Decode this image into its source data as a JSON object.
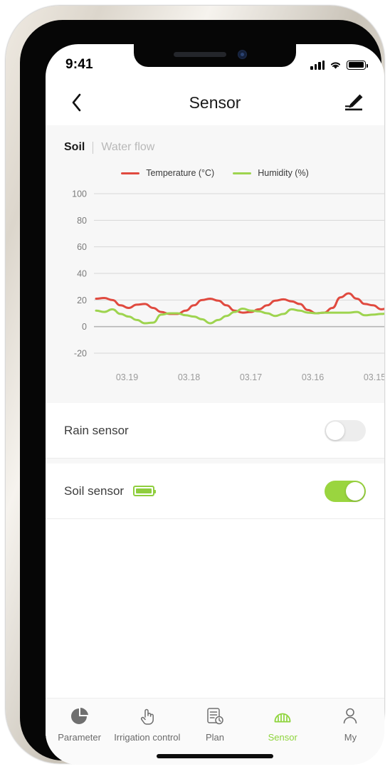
{
  "status_bar": {
    "time": "9:41",
    "signal_icon": "cellular-signal-icon",
    "wifi_icon": "wifi-icon",
    "battery_icon": "battery-full-icon"
  },
  "header": {
    "back_icon": "chevron-left-icon",
    "title": "Sensor",
    "edit_icon": "pencil-edit-icon"
  },
  "tabs": [
    {
      "label": "Soil",
      "active": true
    },
    {
      "label": "Water flow",
      "active": false
    }
  ],
  "chart_data": {
    "type": "line",
    "title": "",
    "xlabel": "",
    "ylabel": "",
    "ylim": [
      -20,
      100
    ],
    "yticks": [
      100,
      80,
      60,
      40,
      20,
      0,
      -20
    ],
    "grid": true,
    "legend_position": "top-center",
    "x_tick_labels": [
      "03.19",
      "03.18",
      "03.17",
      "03.16",
      "03.15"
    ],
    "colors": {
      "temperature": "#e04a3f",
      "humidity": "#9ed44f"
    },
    "series": [
      {
        "name": "Temperature (°C)",
        "color": "#e04a3f",
        "values": [
          21,
          21.5,
          20,
          16,
          14,
          16.5,
          17,
          14,
          11,
          9.5,
          9.5,
          12,
          16,
          20,
          21,
          19.5,
          16,
          12,
          10.5,
          11,
          13,
          16,
          19.5,
          20.5,
          19,
          17,
          12.5,
          10,
          10.5,
          14,
          22,
          25,
          21,
          17,
          16,
          13,
          14,
          16,
          17
        ]
      },
      {
        "name": "Humidity (%)",
        "color": "#9ed44f",
        "values": [
          12,
          11,
          13,
          9.5,
          7.5,
          5,
          2.5,
          3,
          9,
          10,
          10,
          8.5,
          7.5,
          5.5,
          2.5,
          5,
          8,
          11,
          13.5,
          12,
          11.5,
          10,
          8,
          9.5,
          13,
          12,
          10.5,
          10,
          10.5,
          10.5,
          10.5,
          10.5,
          11,
          8.5,
          9,
          9.5,
          10,
          11.5,
          12
        ]
      }
    ]
  },
  "sensor_rows": [
    {
      "label": "Rain sensor",
      "toggle_on": false,
      "has_battery": false
    },
    {
      "label": "Soil sensor",
      "toggle_on": true,
      "has_battery": true,
      "battery_icon": "battery-full-green-icon"
    }
  ],
  "bottom_nav": [
    {
      "label": "Parameter",
      "icon": "pie-chart-icon",
      "active": false
    },
    {
      "label": "Irrigation control",
      "icon": "tap-hand-icon",
      "active": false
    },
    {
      "label": "Plan",
      "icon": "document-clock-icon",
      "active": false
    },
    {
      "label": "Sensor",
      "icon": "sensor-waves-icon",
      "active": true
    },
    {
      "label": "My",
      "icon": "person-icon",
      "active": false
    }
  ],
  "colors": {
    "accent_green": "#8ed43c",
    "line_red": "#e04a3f",
    "line_green": "#9ed44f",
    "panel_bg": "#f7f7f7"
  }
}
